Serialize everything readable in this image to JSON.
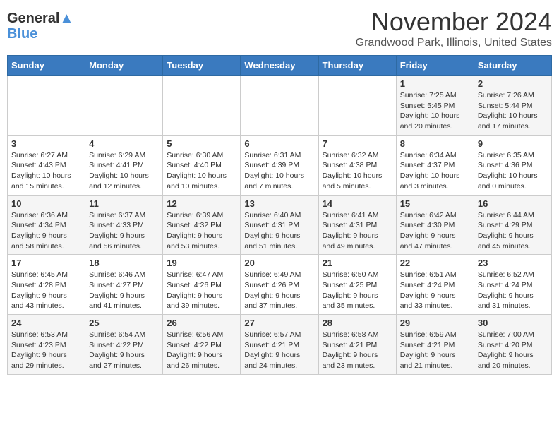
{
  "header": {
    "logo_line1": "General",
    "logo_line2": "Blue",
    "title": "November 2024",
    "subtitle": "Grandwood Park, Illinois, United States"
  },
  "days_of_week": [
    "Sunday",
    "Monday",
    "Tuesday",
    "Wednesday",
    "Thursday",
    "Friday",
    "Saturday"
  ],
  "weeks": [
    [
      {
        "day": "",
        "info": ""
      },
      {
        "day": "",
        "info": ""
      },
      {
        "day": "",
        "info": ""
      },
      {
        "day": "",
        "info": ""
      },
      {
        "day": "",
        "info": ""
      },
      {
        "day": "1",
        "info": "Sunrise: 7:25 AM\nSunset: 5:45 PM\nDaylight: 10 hours and 20 minutes."
      },
      {
        "day": "2",
        "info": "Sunrise: 7:26 AM\nSunset: 5:44 PM\nDaylight: 10 hours and 17 minutes."
      }
    ],
    [
      {
        "day": "3",
        "info": "Sunrise: 6:27 AM\nSunset: 4:43 PM\nDaylight: 10 hours and 15 minutes."
      },
      {
        "day": "4",
        "info": "Sunrise: 6:29 AM\nSunset: 4:41 PM\nDaylight: 10 hours and 12 minutes."
      },
      {
        "day": "5",
        "info": "Sunrise: 6:30 AM\nSunset: 4:40 PM\nDaylight: 10 hours and 10 minutes."
      },
      {
        "day": "6",
        "info": "Sunrise: 6:31 AM\nSunset: 4:39 PM\nDaylight: 10 hours and 7 minutes."
      },
      {
        "day": "7",
        "info": "Sunrise: 6:32 AM\nSunset: 4:38 PM\nDaylight: 10 hours and 5 minutes."
      },
      {
        "day": "8",
        "info": "Sunrise: 6:34 AM\nSunset: 4:37 PM\nDaylight: 10 hours and 3 minutes."
      },
      {
        "day": "9",
        "info": "Sunrise: 6:35 AM\nSunset: 4:36 PM\nDaylight: 10 hours and 0 minutes."
      }
    ],
    [
      {
        "day": "10",
        "info": "Sunrise: 6:36 AM\nSunset: 4:34 PM\nDaylight: 9 hours and 58 minutes."
      },
      {
        "day": "11",
        "info": "Sunrise: 6:37 AM\nSunset: 4:33 PM\nDaylight: 9 hours and 56 minutes."
      },
      {
        "day": "12",
        "info": "Sunrise: 6:39 AM\nSunset: 4:32 PM\nDaylight: 9 hours and 53 minutes."
      },
      {
        "day": "13",
        "info": "Sunrise: 6:40 AM\nSunset: 4:31 PM\nDaylight: 9 hours and 51 minutes."
      },
      {
        "day": "14",
        "info": "Sunrise: 6:41 AM\nSunset: 4:31 PM\nDaylight: 9 hours and 49 minutes."
      },
      {
        "day": "15",
        "info": "Sunrise: 6:42 AM\nSunset: 4:30 PM\nDaylight: 9 hours and 47 minutes."
      },
      {
        "day": "16",
        "info": "Sunrise: 6:44 AM\nSunset: 4:29 PM\nDaylight: 9 hours and 45 minutes."
      }
    ],
    [
      {
        "day": "17",
        "info": "Sunrise: 6:45 AM\nSunset: 4:28 PM\nDaylight: 9 hours and 43 minutes."
      },
      {
        "day": "18",
        "info": "Sunrise: 6:46 AM\nSunset: 4:27 PM\nDaylight: 9 hours and 41 minutes."
      },
      {
        "day": "19",
        "info": "Sunrise: 6:47 AM\nSunset: 4:26 PM\nDaylight: 9 hours and 39 minutes."
      },
      {
        "day": "20",
        "info": "Sunrise: 6:49 AM\nSunset: 4:26 PM\nDaylight: 9 hours and 37 minutes."
      },
      {
        "day": "21",
        "info": "Sunrise: 6:50 AM\nSunset: 4:25 PM\nDaylight: 9 hours and 35 minutes."
      },
      {
        "day": "22",
        "info": "Sunrise: 6:51 AM\nSunset: 4:24 PM\nDaylight: 9 hours and 33 minutes."
      },
      {
        "day": "23",
        "info": "Sunrise: 6:52 AM\nSunset: 4:24 PM\nDaylight: 9 hours and 31 minutes."
      }
    ],
    [
      {
        "day": "24",
        "info": "Sunrise: 6:53 AM\nSunset: 4:23 PM\nDaylight: 9 hours and 29 minutes."
      },
      {
        "day": "25",
        "info": "Sunrise: 6:54 AM\nSunset: 4:22 PM\nDaylight: 9 hours and 27 minutes."
      },
      {
        "day": "26",
        "info": "Sunrise: 6:56 AM\nSunset: 4:22 PM\nDaylight: 9 hours and 26 minutes."
      },
      {
        "day": "27",
        "info": "Sunrise: 6:57 AM\nSunset: 4:21 PM\nDaylight: 9 hours and 24 minutes."
      },
      {
        "day": "28",
        "info": "Sunrise: 6:58 AM\nSunset: 4:21 PM\nDaylight: 9 hours and 23 minutes."
      },
      {
        "day": "29",
        "info": "Sunrise: 6:59 AM\nSunset: 4:21 PM\nDaylight: 9 hours and 21 minutes."
      },
      {
        "day": "30",
        "info": "Sunrise: 7:00 AM\nSunset: 4:20 PM\nDaylight: 9 hours and 20 minutes."
      }
    ]
  ]
}
